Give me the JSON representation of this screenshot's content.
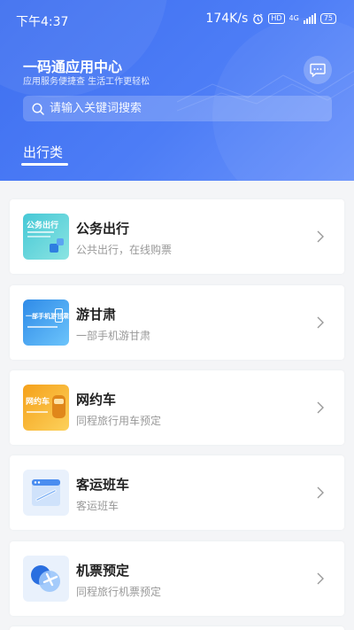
{
  "status_bar": {
    "time": "下午4:37",
    "speed": "174K/s",
    "hd": "HD",
    "net": "4G",
    "battery": "75"
  },
  "header": {
    "title": "一码通应用中心",
    "subtitle": "应用服务便捷查  生活工作更轻松",
    "message_icon": "chat-bubble-icon"
  },
  "search": {
    "placeholder": "请输入关键词搜索",
    "value": ""
  },
  "tabs": [
    {
      "label": "出行类",
      "active": true
    }
  ],
  "cards": [
    {
      "title": "公务出行",
      "desc": "公共出行，在线购票",
      "icon_text": "公务出行",
      "icon_colors": [
        "#4fcfd6",
        "#7ee0e0"
      ],
      "icon": "business-travel-icon"
    },
    {
      "title": "游甘肃",
      "desc": "一部手机游甘肃",
      "icon_text": "一部手机游甘肃",
      "icon_colors": [
        "#3aa0f0",
        "#64c0fb"
      ],
      "icon": "travel-gansu-icon"
    },
    {
      "title": "网约车",
      "desc": "同程旅行用车预定",
      "icon_text": "网约车",
      "icon_colors": [
        "#f7a820",
        "#fbc74e"
      ],
      "icon": "ride-hailing-icon"
    },
    {
      "title": "客运班车",
      "desc": "客运班车",
      "icon_text": "",
      "icon_colors": [
        "#e8f1fd",
        "#e8f1fd"
      ],
      "icon": "coach-bus-icon"
    },
    {
      "title": "机票预定",
      "desc": "同程旅行机票预定",
      "icon_text": "",
      "icon_colors": [
        "#e8f1fd",
        "#e8f1fd"
      ],
      "icon": "airplane-ticket-icon"
    }
  ],
  "colors": {
    "header_blue": "#4074f2",
    "page_bg": "#f4f5f7"
  }
}
